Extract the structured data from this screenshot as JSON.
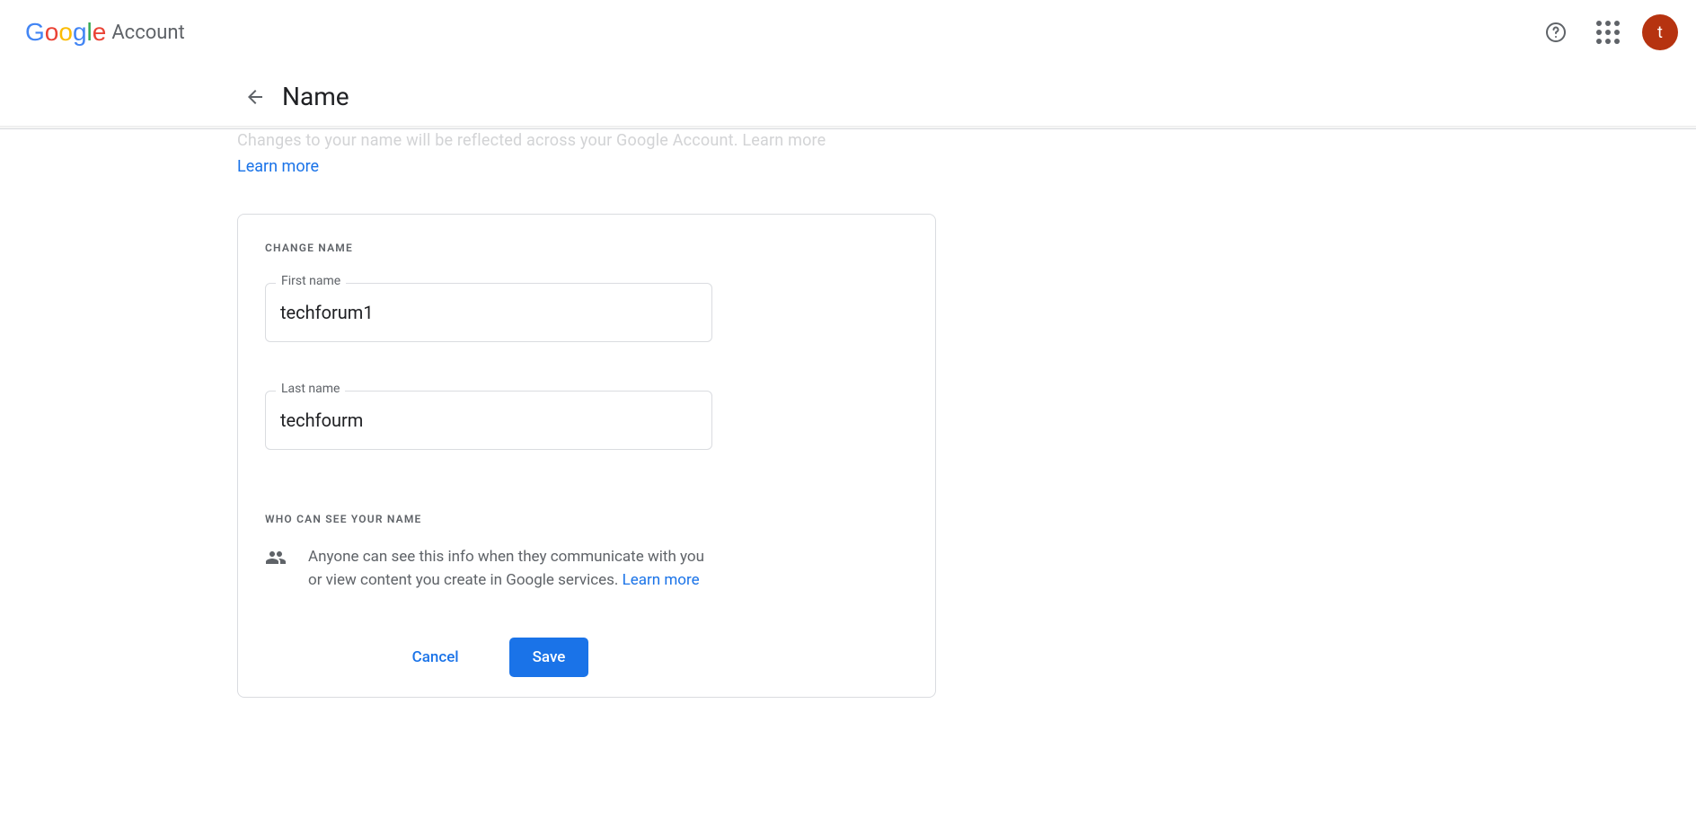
{
  "header": {
    "product": "Account",
    "avatar_initial": "t"
  },
  "page": {
    "title": "Name",
    "intro_faded": "Changes to your name will be reflected across your Google Account.",
    "learn_more": "Learn more"
  },
  "card": {
    "change_label": "CHANGE NAME",
    "first_label": "First name",
    "first_value": "techforum1",
    "last_label": "Last name",
    "last_value": "techfourm",
    "privacy_label": "WHO CAN SEE YOUR NAME",
    "privacy_text": "Anyone can see this info when they communicate with you or view content you create in Google services. ",
    "privacy_learn_more": "Learn more",
    "cancel": "Cancel",
    "save": "Save"
  }
}
